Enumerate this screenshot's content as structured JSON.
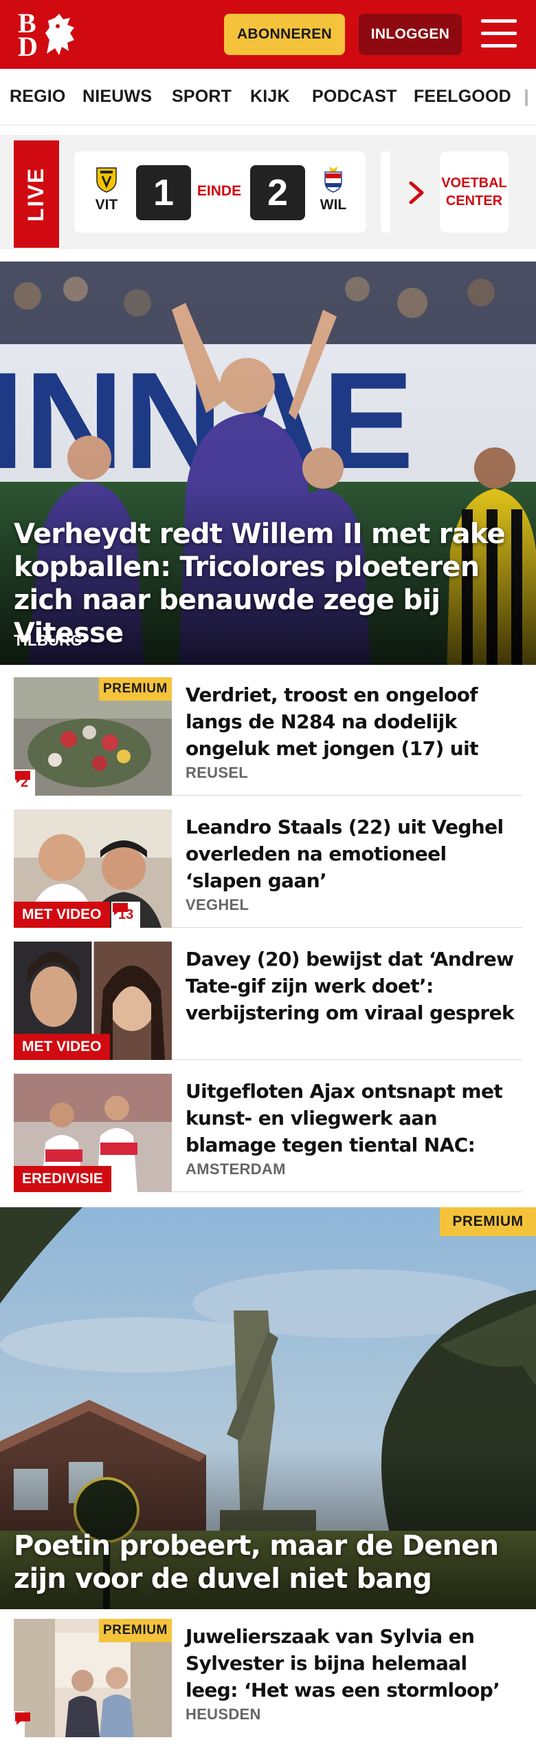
{
  "header": {
    "logo_b": "B",
    "logo_d": "D",
    "subscribe_label": "ABONNEREN",
    "login_label": "INLOGGEN",
    "brand_color": "#d10a11",
    "accent_color": "#f5c33b"
  },
  "nav": {
    "items": [
      {
        "label": "REGIO"
      },
      {
        "label": "NIEUWS"
      },
      {
        "label": "SPORT"
      },
      {
        "label": "KIJK"
      },
      {
        "label": "PODCAST"
      },
      {
        "label": "FEELGOOD"
      }
    ]
  },
  "live": {
    "tag": "LIVE",
    "match": {
      "home_abbr": "VIT",
      "away_abbr": "WIL",
      "home_score": "1",
      "away_score": "2",
      "status": "EINDE"
    },
    "voetbal_center": "VOETBAL CENTER"
  },
  "hero": {
    "title": "Verheydt redt Willem II met rake kopballen: Tricolores ploeteren zich naar benauwde zege bij Vitesse",
    "location": "TILBURG"
  },
  "articles": [
    {
      "title": "Verdriet, troost en ongeloof langs de N284 na dodelijk ongeluk met jongen (17) uit Reusel",
      "location": "REUSEL",
      "premium": "PREMIUM",
      "comments": "2"
    },
    {
      "title": "Leandro Staals (22) uit Veghel overleden na emotioneel ‘slapen gaan’",
      "location": "VEGHEL",
      "badge": "MET VIDEO",
      "comments": "13"
    },
    {
      "title": "Davey (20) bewijst dat ‘Andrew Tate-gif zijn werk doet’: verbijstering om viraal gesprek",
      "badge": "MET VIDEO"
    },
    {
      "title": "Uitgefloten Ajax ontsnapt met kunst- en vliegwerk aan blamage tegen tiental NAC: ‘Dan ziet het er anders uit’",
      "location": "AMSTERDAM",
      "badge": "EREDIVISIE"
    }
  ],
  "feature": {
    "title": "Poetin probeert, maar de Denen zijn voor de duvel niet bang",
    "premium": "PREMIUM"
  },
  "article_5": {
    "title": "Juwelierszaak van Sylvia en Sylvester is bijna helemaal leeg: ‘Het was een stormloop’",
    "location": "HEUSDEN",
    "premium": "PREMIUM"
  }
}
